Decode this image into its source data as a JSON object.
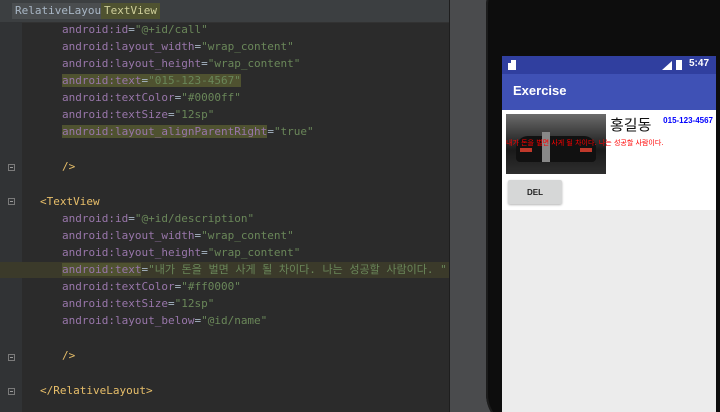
{
  "breadcrumb": {
    "items": [
      "RelativeLayout",
      "TextView"
    ]
  },
  "code": {
    "l1": {
      "ns": "android",
      "attr": ":id",
      "eq": "=",
      "val": "\"@+id/call\""
    },
    "l2": {
      "ns": "android",
      "attr": ":layout_width",
      "eq": "=",
      "val": "\"wrap_content\""
    },
    "l3": {
      "ns": "android",
      "attr": ":layout_height",
      "eq": "=",
      "val": "\"wrap_content\""
    },
    "l4": {
      "ns": "android",
      "attr": ":text",
      "eq": "=",
      "val": "\"015-123-4567\""
    },
    "l5": {
      "ns": "android",
      "attr": ":textColor",
      "eq": "=",
      "val": "\"#0000ff\""
    },
    "l6": {
      "ns": "android",
      "attr": ":textSize",
      "eq": "=",
      "val": "\"12sp\""
    },
    "l7": {
      "ns": "android",
      "attr": ":layout_alignParentRight",
      "eq": "=",
      "val": "\"true\""
    },
    "l8": {
      "text": "/>"
    },
    "l9": {
      "text": "<TextView"
    },
    "l10": {
      "ns": "android",
      "attr": ":id",
      "eq": "=",
      "val": "\"@+id/description\""
    },
    "l11": {
      "ns": "android",
      "attr": ":layout_width",
      "eq": "=",
      "val": "\"wrap_content\""
    },
    "l12": {
      "ns": "android",
      "attr": ":layout_height",
      "eq": "=",
      "val": "\"wrap_content\""
    },
    "l13": {
      "ns": "android",
      "attr": ":text",
      "eq": "=",
      "val": "\"내가 돈을 벌면 사게 될 차이다. 나는 성공할 사람이다. \""
    },
    "l14": {
      "ns": "android",
      "attr": ":textColor",
      "eq": "=",
      "val": "\"#ff0000\""
    },
    "l15": {
      "ns": "android",
      "attr": ":textSize",
      "eq": "=",
      "val": "\"12sp\""
    },
    "l16": {
      "ns": "android",
      "attr": ":layout_below",
      "eq": "=",
      "val": "\"@id/name\""
    },
    "l17": {
      "text": "/>"
    },
    "l18": {
      "text": "</RelativeLayout>"
    }
  },
  "device": {
    "status_time": "5:47",
    "app_title": "Exercise",
    "name": "홍길동",
    "call": "015-123-4567",
    "description": "내가 돈을 벌면 사게 될 차이다. 나는 성공할 사람이다.",
    "del_button": "DEL"
  },
  "colors": {
    "status_bar": "#303f9f",
    "app_bar": "#3f51b5",
    "call_text": "#0000ff",
    "description_text": "#ff0000"
  }
}
